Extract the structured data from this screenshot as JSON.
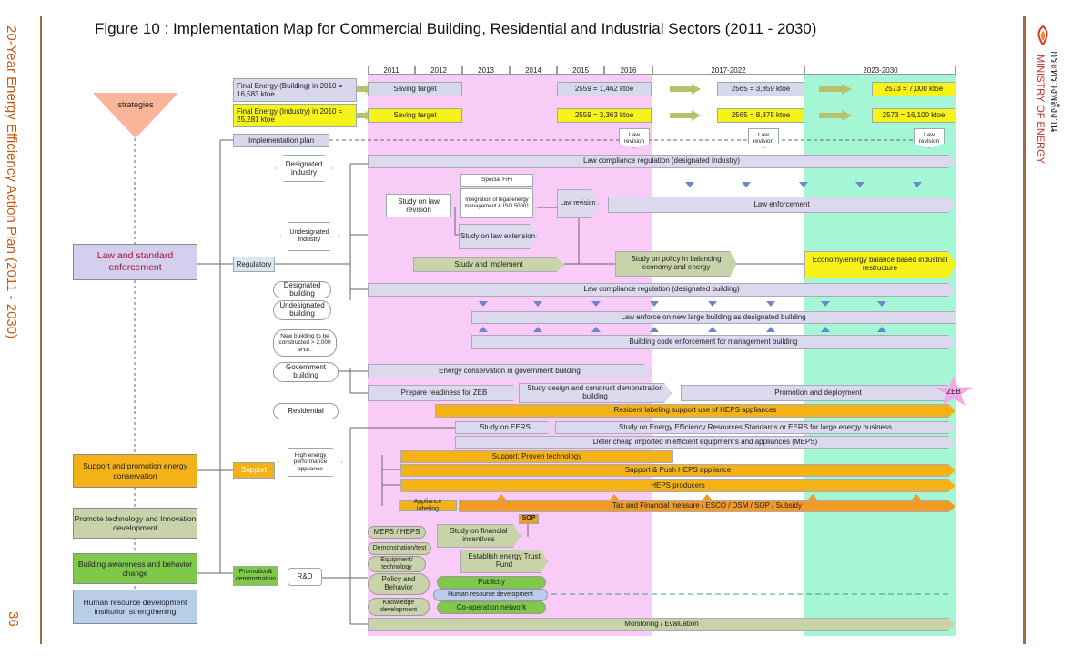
{
  "header": {
    "figure_label": "Figure 10",
    "title": ": Implementation Map for Commercial Building, Residential and Industrial Sectors (2011 - 2030)"
  },
  "side": {
    "left": "20-Year Energy Efficiency Action Plan (2011 - 2030)",
    "page": "36",
    "right_thai": "กระทรวงพลังงาน",
    "right_en": "MINISTRY OF ENERGY"
  },
  "years": [
    "2011",
    "2012",
    "2013",
    "2014",
    "2015",
    "2016",
    "2017-2022",
    "2023-2030"
  ],
  "strategies": {
    "heading": "strategies",
    "law": "Law and standard enforcement",
    "support": "Support and promotion energy conservation",
    "tech": "Promote technology and Innovation development",
    "aware": "Building awareness and behavior change",
    "hr": "Human resource development institution strengthening"
  },
  "targets": {
    "building": "Final Energy (Building) in 2010 = 16,583 ktoe",
    "industry": "Final Energy (Industry) in 2010 = 25,281 ktoe",
    "saving": "Saving target",
    "b1": "2559 = 1,462 ktoe",
    "b2": "2565 = 3,859 ktoe",
    "b3": "2573 = 7,000 ktoe",
    "i1": "2559 = 3,363 ktoe",
    "i2": "2565 = 8,875 ktoe",
    "i3": "2573 = 16,100 ktoe"
  },
  "impl": {
    "plan": "Implementation plan",
    "law_revision": "Law revision"
  },
  "groups": {
    "regulatory": "Regulatory",
    "support": "Support",
    "promotion": "Promotion& demonstration",
    "rd": "R&D"
  },
  "targets_left": {
    "des_ind": "Designated industry",
    "undes_ind": "Undesignated industry",
    "des_bld": "Designated building",
    "undes_bld": "Undesignated building",
    "new_bld": "New building to be constructed > 2,000 ตรม.",
    "gov_bld": "Government building",
    "residential": "Residential",
    "high_energy": "High energy performance appliance"
  },
  "items": {
    "law_comp_ind": "Law compliance regulation (designated Industry)",
    "special_fifi": "Special FiFi",
    "study_law_rev": "Study on law revision",
    "integration": "Integration of legal energy management & ISO 50001",
    "law_rev": "Law revision",
    "law_enforce": "Law enforcement",
    "study_law_ext": "Study on law extension",
    "study_impl": "Study and implement",
    "study_policy": "Study on policy in balancing economy and energy",
    "econ_balance": "Economy/energy balance based industrial restructure",
    "law_comp_bld": "Law compliance regulation (designated building)",
    "law_enforce_new": "Law enforce on new large building as designated building",
    "bld_code": "Building code enforcement for management building",
    "energy_gov": "Energy conservation in government building",
    "prepare_zeb": "Prepare readiness for ZEB",
    "study_design": "Study design and construct demonstration building",
    "promo_deploy": "Promotion and deployment",
    "zeb": "ZEB",
    "resident_label": "Resident labeling support use of HEPS appliances",
    "study_eers": "Study on EERS",
    "study_eers_long": "Study on Energy Efficiency Resources Standards or EERS for large energy business",
    "deter": "Deter cheap imported in efficient equipment's and appliances (MEPS)",
    "support_proven": "Support: Proven technology",
    "support_push": "Support & Push HEPS appliance",
    "heps_producers": "HEPS producers",
    "appliance_label": "Appliance labeling",
    "tax": "Tax and Financial measure / ESCO / DSM / SOP / Subsidy",
    "sop": "SOP",
    "meps": "MEPS / HEPS",
    "study_fin": "Study on financial incentives",
    "demo_test": "Demonstration/test",
    "equip": "Equipment/ technology",
    "trust": "Establish energy Trust Fund",
    "policy_beh": "Policy and Behavior",
    "publicity": "Publicity",
    "hr_dev": "Human resource development",
    "knowledge": "Knowledge development",
    "coop": "Co-operation network",
    "monitoring": "Monitoring / Evaluation"
  }
}
